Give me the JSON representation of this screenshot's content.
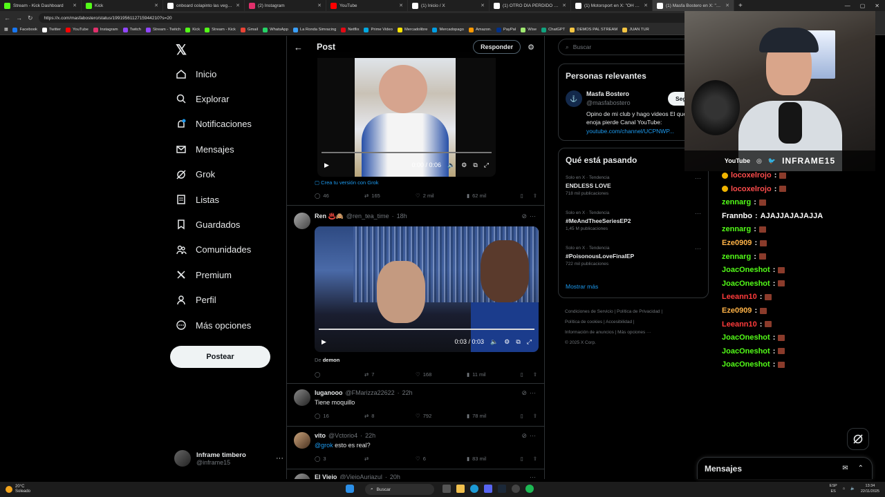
{
  "browser": {
    "tabs": [
      {
        "title": "Stream - Kick Dashboard",
        "color": "#53fc18"
      },
      {
        "title": "Kick",
        "color": "#53fc18"
      },
      {
        "title": "onboard colapinto las vegas - Bu...",
        "color": "#ffffff"
      },
      {
        "title": "(2) Instagram",
        "color": "#e1306c"
      },
      {
        "title": "YouTube",
        "color": "#ff0000"
      },
      {
        "title": "(1) Inicio / X",
        "color": "#ffffff"
      },
      {
        "title": "(1) OTRO DÍA PERDIDO en X: \"...",
        "color": "#ffffff"
      },
      {
        "title": "(1) Motorsport en X: \"OH MY GO...",
        "color": "#ffffff"
      },
      {
        "title": "(1) Masfa Bostero en X: \"Cha...",
        "color": "#ffffff"
      }
    ],
    "url": "https://x.com/masfabostero/status/1991956112715944210?s=20",
    "bookmarks": [
      {
        "label": "Facebook",
        "color": "#1877f2"
      },
      {
        "label": "Twitter",
        "color": "#ffffff"
      },
      {
        "label": "YouTube",
        "color": "#ff0000"
      },
      {
        "label": "Instagram",
        "color": "#e1306c"
      },
      {
        "label": "Twitch",
        "color": "#9146ff"
      },
      {
        "label": "Stream - Twitch",
        "color": "#9146ff"
      },
      {
        "label": "Kick",
        "color": "#53fc18"
      },
      {
        "label": "Stream - Kick",
        "color": "#53fc18"
      },
      {
        "label": "Gmail",
        "color": "#ea4335"
      },
      {
        "label": "WhatsApp",
        "color": "#25d366"
      },
      {
        "label": "La Ronda Simracing",
        "color": "#3aa0ff"
      },
      {
        "label": "Netflix",
        "color": "#e50914"
      },
      {
        "label": "Prime Video",
        "color": "#00a8e1"
      },
      {
        "label": "Mercadolibre",
        "color": "#ffe600"
      },
      {
        "label": "Mercadopago",
        "color": "#009ee3"
      },
      {
        "label": "Amazon.",
        "color": "#ff9900"
      },
      {
        "label": "PayPal",
        "color": "#003087"
      },
      {
        "label": "Wise",
        "color": "#9fe870"
      },
      {
        "label": "ChatGPT",
        "color": "#10a37f"
      },
      {
        "label": "DEMOS PAL STREAM",
        "color": "#f4c542"
      },
      {
        "label": "JUAN TUR",
        "color": "#f4c542"
      }
    ]
  },
  "nav": {
    "items": [
      {
        "label": "Inicio",
        "icon": "home-icon"
      },
      {
        "label": "Explorar",
        "icon": "search-icon"
      },
      {
        "label": "Notificaciones",
        "icon": "bell-icon"
      },
      {
        "label": "Mensajes",
        "icon": "mail-icon"
      },
      {
        "label": "Grok",
        "icon": "grok-icon"
      },
      {
        "label": "Listas",
        "icon": "list-icon"
      },
      {
        "label": "Guardados",
        "icon": "bookmark-icon"
      },
      {
        "label": "Comunidades",
        "icon": "people-icon"
      },
      {
        "label": "Premium",
        "icon": "x-icon"
      },
      {
        "label": "Perfil",
        "icon": "person-icon"
      },
      {
        "label": "Más opciones",
        "icon": "more-icon"
      }
    ],
    "post_label": "Postear",
    "account": {
      "name": "Inframe timbero",
      "handle": "@inframe15"
    }
  },
  "header": {
    "title": "Post",
    "reply_label": "Responder"
  },
  "post": {
    "video_time": "0:00 / 0:06",
    "grok_link": "Crea tu versión con Grok",
    "stats": {
      "replies": "46",
      "reposts": "165",
      "likes": "2 mil",
      "views": "62 mil"
    }
  },
  "replies": [
    {
      "name": "Ren ♨️🙈",
      "handle": "@ren_tea_time",
      "time": "18h",
      "video_time": "0:03 / 0:03",
      "from_prefix": "De",
      "from_user": "demon",
      "stats": {
        "replies": "",
        "reposts": "7",
        "likes": "168",
        "views": "11 mil"
      }
    },
    {
      "name": "luganooo",
      "handle": "@FMarizza22622",
      "time": "22h",
      "text": "Tiene moquillo",
      "stats": {
        "replies": "16",
        "reposts": "8",
        "likes": "792",
        "views": "78 mil"
      }
    },
    {
      "name": "vito",
      "handle": "@Vctorio4",
      "time": "22h",
      "mention": "@grok",
      "text": " esto es real?",
      "stats": {
        "replies": "3",
        "reposts": "",
        "likes": "6",
        "views": "83 mil"
      }
    },
    {
      "name": "El Viejo",
      "handle": "@ViejoAuriazul",
      "time": "20h"
    }
  ],
  "sidebar": {
    "search_placeholder": "Buscar",
    "relevant_title": "Personas relevantes",
    "relevant": {
      "name": "Masfa Bostero",
      "handle": "@masfabostero",
      "follow_label": "Seguir",
      "bio": "Opino de mi club y hago videos El que se enoja pierde Canal YouTube:",
      "link": "youtube.com/channel/UCPNWP..."
    },
    "trends_title": "Qué está pasando",
    "trends": [
      {
        "category": "Solo en X · Tendencia",
        "name": "ENDLESS LOVE",
        "count": "718 mil publicaciones"
      },
      {
        "category": "Solo en X · Tendencia",
        "name": "#MeAndTheeSeriesEP2",
        "count": "1,45 M publicaciones"
      },
      {
        "category": "Solo en X · Tendencia",
        "name": "#PoisonousLoveFinalEP",
        "count": "722 mil publicaciones"
      }
    ],
    "show_more": "Mostrar más",
    "footer": [
      "Condiciones de Servicio",
      "Política de Privacidad",
      "Política de cookies",
      "Accesibilidad",
      "Información de anuncios",
      "Más opciones ···",
      "© 2025 X Corp."
    ]
  },
  "overlay": {
    "social_label": "YouTube",
    "brand": "INFRAME15",
    "chat": [
      {
        "user": "locoxelrojo",
        "color": "#ff4d4d",
        "badge": true,
        "text": ""
      },
      {
        "user": "locoxelrojo",
        "color": "#ff4d4d",
        "badge": true,
        "text": ""
      },
      {
        "user": "zennarg",
        "color": "#53fc18",
        "badge": false,
        "text": ""
      },
      {
        "user": "Frannbo",
        "color": "#ffffff",
        "badge": false,
        "text": "AJAJJAJAJAJJA"
      },
      {
        "user": "zennarg",
        "color": "#53fc18",
        "badge": false,
        "text": ""
      },
      {
        "user": "Eze0909",
        "color": "#ffb347",
        "badge": false,
        "text": ""
      },
      {
        "user": "zennarg",
        "color": "#53fc18",
        "badge": false,
        "text": ""
      },
      {
        "user": "JoacOneshot",
        "color": "#53fc18",
        "badge": false,
        "text": ""
      },
      {
        "user": "JoacOneshot",
        "color": "#53fc18",
        "badge": false,
        "text": ""
      },
      {
        "user": "Leeann10",
        "color": "#ff3b3b",
        "badge": false,
        "text": ""
      },
      {
        "user": "Eze0909",
        "color": "#ffb347",
        "badge": false,
        "text": ""
      },
      {
        "user": "Leeann10",
        "color": "#ff3b3b",
        "badge": false,
        "text": ""
      },
      {
        "user": "JoacOneshot",
        "color": "#53fc18",
        "badge": false,
        "text": ""
      },
      {
        "user": "JoacOneshot",
        "color": "#53fc18",
        "badge": false,
        "text": ""
      },
      {
        "user": "JoacOneshot",
        "color": "#53fc18",
        "badge": false,
        "text": ""
      }
    ]
  },
  "messages_dock": {
    "title": "Mensajes"
  },
  "taskbar": {
    "weather_temp": "20°C",
    "weather_text": "Soleado",
    "search": "Buscar",
    "lang": "ESP",
    "lang2": "ES",
    "time": "13:34",
    "date": "22/11/2025"
  }
}
